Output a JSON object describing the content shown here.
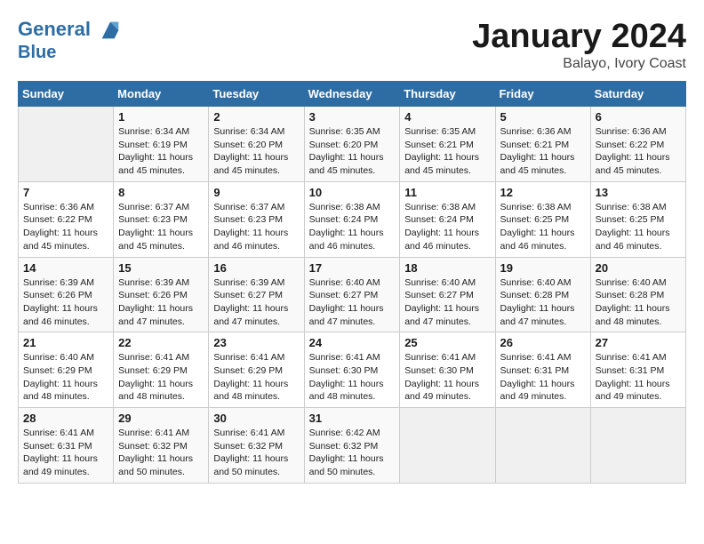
{
  "header": {
    "logo_line1": "General",
    "logo_line2": "Blue",
    "month": "January 2024",
    "location": "Balayo, Ivory Coast"
  },
  "days_of_week": [
    "Sunday",
    "Monday",
    "Tuesday",
    "Wednesday",
    "Thursday",
    "Friday",
    "Saturday"
  ],
  "weeks": [
    [
      {
        "day": "",
        "sunrise": "",
        "sunset": "",
        "daylight": "",
        "empty": true
      },
      {
        "day": "1",
        "sunrise": "Sunrise: 6:34 AM",
        "sunset": "Sunset: 6:19 PM",
        "daylight": "Daylight: 11 hours and 45 minutes."
      },
      {
        "day": "2",
        "sunrise": "Sunrise: 6:34 AM",
        "sunset": "Sunset: 6:20 PM",
        "daylight": "Daylight: 11 hours and 45 minutes."
      },
      {
        "day": "3",
        "sunrise": "Sunrise: 6:35 AM",
        "sunset": "Sunset: 6:20 PM",
        "daylight": "Daylight: 11 hours and 45 minutes."
      },
      {
        "day": "4",
        "sunrise": "Sunrise: 6:35 AM",
        "sunset": "Sunset: 6:21 PM",
        "daylight": "Daylight: 11 hours and 45 minutes."
      },
      {
        "day": "5",
        "sunrise": "Sunrise: 6:36 AM",
        "sunset": "Sunset: 6:21 PM",
        "daylight": "Daylight: 11 hours and 45 minutes."
      },
      {
        "day": "6",
        "sunrise": "Sunrise: 6:36 AM",
        "sunset": "Sunset: 6:22 PM",
        "daylight": "Daylight: 11 hours and 45 minutes."
      }
    ],
    [
      {
        "day": "7",
        "sunrise": "Sunrise: 6:36 AM",
        "sunset": "Sunset: 6:22 PM",
        "daylight": "Daylight: 11 hours and 45 minutes."
      },
      {
        "day": "8",
        "sunrise": "Sunrise: 6:37 AM",
        "sunset": "Sunset: 6:23 PM",
        "daylight": "Daylight: 11 hours and 45 minutes."
      },
      {
        "day": "9",
        "sunrise": "Sunrise: 6:37 AM",
        "sunset": "Sunset: 6:23 PM",
        "daylight": "Daylight: 11 hours and 46 minutes."
      },
      {
        "day": "10",
        "sunrise": "Sunrise: 6:38 AM",
        "sunset": "Sunset: 6:24 PM",
        "daylight": "Daylight: 11 hours and 46 minutes."
      },
      {
        "day": "11",
        "sunrise": "Sunrise: 6:38 AM",
        "sunset": "Sunset: 6:24 PM",
        "daylight": "Daylight: 11 hours and 46 minutes."
      },
      {
        "day": "12",
        "sunrise": "Sunrise: 6:38 AM",
        "sunset": "Sunset: 6:25 PM",
        "daylight": "Daylight: 11 hours and 46 minutes."
      },
      {
        "day": "13",
        "sunrise": "Sunrise: 6:38 AM",
        "sunset": "Sunset: 6:25 PM",
        "daylight": "Daylight: 11 hours and 46 minutes."
      }
    ],
    [
      {
        "day": "14",
        "sunrise": "Sunrise: 6:39 AM",
        "sunset": "Sunset: 6:26 PM",
        "daylight": "Daylight: 11 hours and 46 minutes."
      },
      {
        "day": "15",
        "sunrise": "Sunrise: 6:39 AM",
        "sunset": "Sunset: 6:26 PM",
        "daylight": "Daylight: 11 hours and 47 minutes."
      },
      {
        "day": "16",
        "sunrise": "Sunrise: 6:39 AM",
        "sunset": "Sunset: 6:27 PM",
        "daylight": "Daylight: 11 hours and 47 minutes."
      },
      {
        "day": "17",
        "sunrise": "Sunrise: 6:40 AM",
        "sunset": "Sunset: 6:27 PM",
        "daylight": "Daylight: 11 hours and 47 minutes."
      },
      {
        "day": "18",
        "sunrise": "Sunrise: 6:40 AM",
        "sunset": "Sunset: 6:27 PM",
        "daylight": "Daylight: 11 hours and 47 minutes."
      },
      {
        "day": "19",
        "sunrise": "Sunrise: 6:40 AM",
        "sunset": "Sunset: 6:28 PM",
        "daylight": "Daylight: 11 hours and 47 minutes."
      },
      {
        "day": "20",
        "sunrise": "Sunrise: 6:40 AM",
        "sunset": "Sunset: 6:28 PM",
        "daylight": "Daylight: 11 hours and 48 minutes."
      }
    ],
    [
      {
        "day": "21",
        "sunrise": "Sunrise: 6:40 AM",
        "sunset": "Sunset: 6:29 PM",
        "daylight": "Daylight: 11 hours and 48 minutes."
      },
      {
        "day": "22",
        "sunrise": "Sunrise: 6:41 AM",
        "sunset": "Sunset: 6:29 PM",
        "daylight": "Daylight: 11 hours and 48 minutes."
      },
      {
        "day": "23",
        "sunrise": "Sunrise: 6:41 AM",
        "sunset": "Sunset: 6:29 PM",
        "daylight": "Daylight: 11 hours and 48 minutes."
      },
      {
        "day": "24",
        "sunrise": "Sunrise: 6:41 AM",
        "sunset": "Sunset: 6:30 PM",
        "daylight": "Daylight: 11 hours and 48 minutes."
      },
      {
        "day": "25",
        "sunrise": "Sunrise: 6:41 AM",
        "sunset": "Sunset: 6:30 PM",
        "daylight": "Daylight: 11 hours and 49 minutes."
      },
      {
        "day": "26",
        "sunrise": "Sunrise: 6:41 AM",
        "sunset": "Sunset: 6:31 PM",
        "daylight": "Daylight: 11 hours and 49 minutes."
      },
      {
        "day": "27",
        "sunrise": "Sunrise: 6:41 AM",
        "sunset": "Sunset: 6:31 PM",
        "daylight": "Daylight: 11 hours and 49 minutes."
      }
    ],
    [
      {
        "day": "28",
        "sunrise": "Sunrise: 6:41 AM",
        "sunset": "Sunset: 6:31 PM",
        "daylight": "Daylight: 11 hours and 49 minutes."
      },
      {
        "day": "29",
        "sunrise": "Sunrise: 6:41 AM",
        "sunset": "Sunset: 6:32 PM",
        "daylight": "Daylight: 11 hours and 50 minutes."
      },
      {
        "day": "30",
        "sunrise": "Sunrise: 6:41 AM",
        "sunset": "Sunset: 6:32 PM",
        "daylight": "Daylight: 11 hours and 50 minutes."
      },
      {
        "day": "31",
        "sunrise": "Sunrise: 6:42 AM",
        "sunset": "Sunset: 6:32 PM",
        "daylight": "Daylight: 11 hours and 50 minutes."
      },
      {
        "day": "",
        "sunrise": "",
        "sunset": "",
        "daylight": "",
        "empty": true
      },
      {
        "day": "",
        "sunrise": "",
        "sunset": "",
        "daylight": "",
        "empty": true
      },
      {
        "day": "",
        "sunrise": "",
        "sunset": "",
        "daylight": "",
        "empty": true
      }
    ]
  ]
}
